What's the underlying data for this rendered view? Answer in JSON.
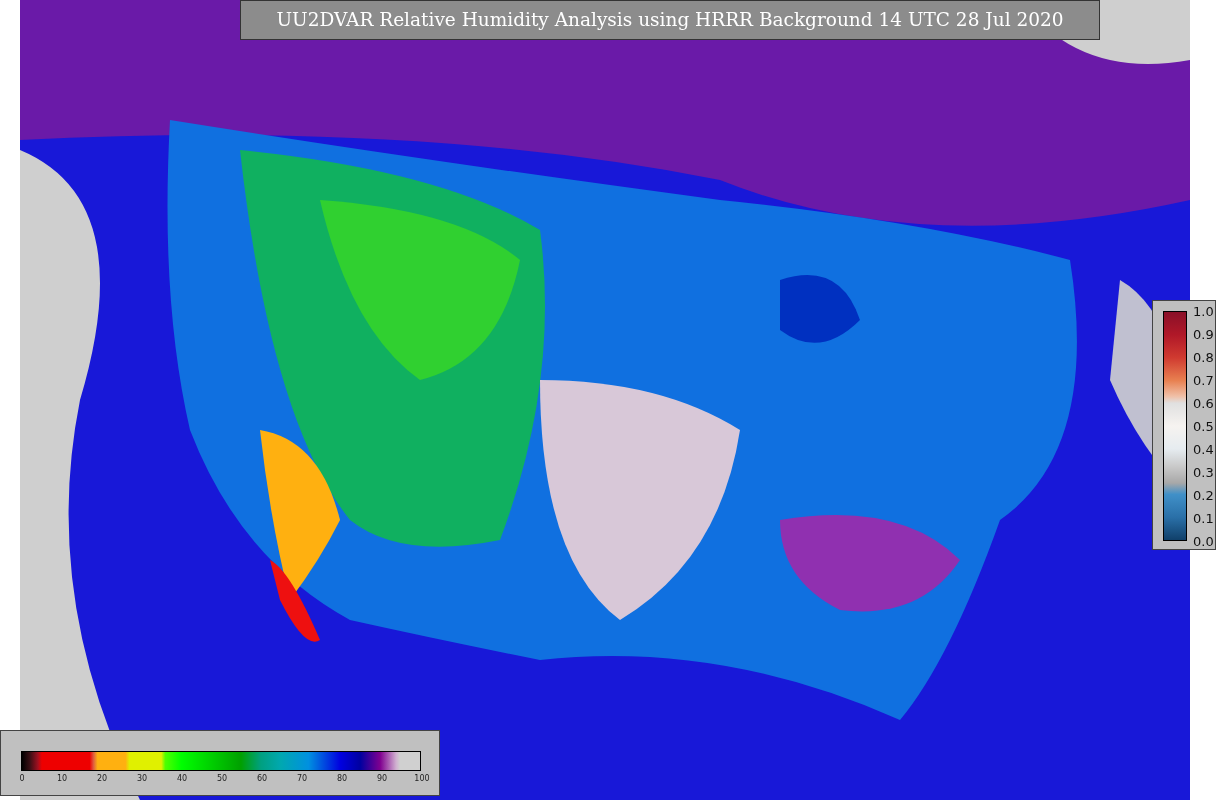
{
  "title": "UU2DVAR Relative Humidity Analysis using HRRR Background 14 UTC 28 Jul 2020",
  "bottom_colorbar": {
    "ticks": [
      "0",
      "10",
      "20",
      "30",
      "40",
      "50",
      "60",
      "70",
      "80",
      "90",
      "100"
    ]
  },
  "side_colorbar": {
    "ticks": [
      "1.0",
      "0.9",
      "0.8",
      "0.7",
      "0.6",
      "0.5",
      "0.4",
      "0.3",
      "0.2",
      "0.1",
      "0.0"
    ]
  }
}
